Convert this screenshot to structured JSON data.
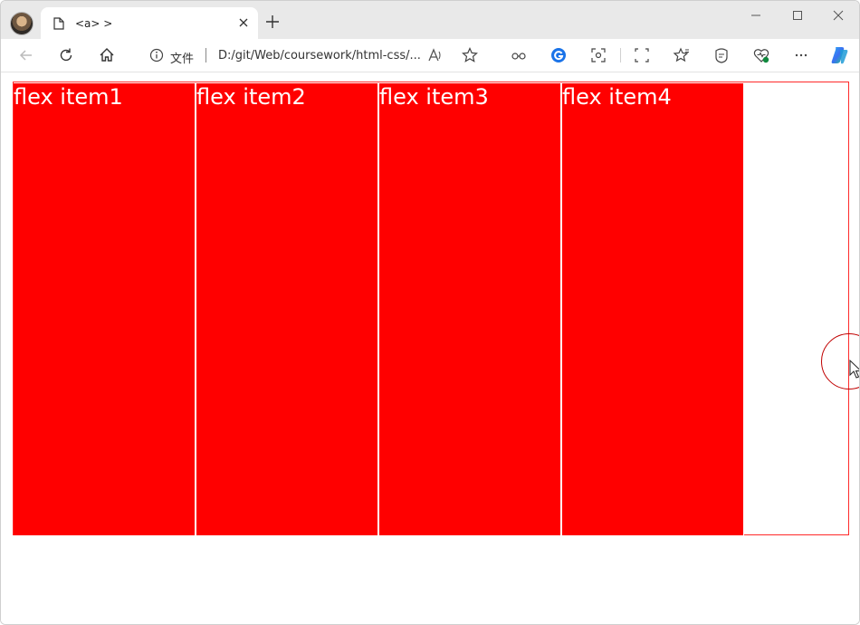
{
  "browser": {
    "tab": {
      "title": "<a> >",
      "close_icon": "close-icon",
      "page_icon": "page-icon"
    },
    "new_tab_icon": "plus-icon",
    "window_controls": [
      "minimize-icon",
      "maximize-icon",
      "close-icon"
    ],
    "toolbar": {
      "back_icon": "arrow-left-icon",
      "refresh_icon": "refresh-icon",
      "home_icon": "home-icon",
      "address": {
        "info_icon": "info-icon",
        "scheme_label": "文件",
        "url": "D:/git/Web/coursework/html-css/..."
      },
      "right_icons": [
        "read-aloud-icon",
        "favorite-star-icon",
        "extension-icon",
        "g-extension-icon",
        "screenshot-icon",
        "split-screen-icon",
        "favorites-icon",
        "collections-icon",
        "browser-essentials-icon",
        "more-icon",
        "copilot-icon"
      ]
    }
  },
  "page": {
    "items": [
      {
        "label": "flex item1"
      },
      {
        "label": "flex item2"
      },
      {
        "label": "flex item3"
      },
      {
        "label": "flex item4"
      }
    ]
  },
  "colors": {
    "item_background": "#ff0000",
    "container_border": "#ff2a2a",
    "item_text": "#ffffff"
  }
}
